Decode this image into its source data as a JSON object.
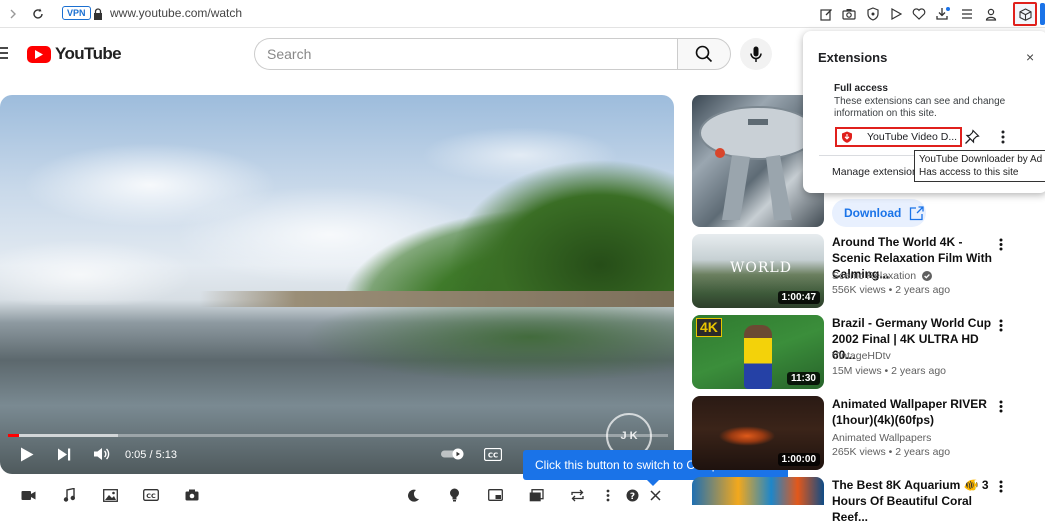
{
  "browser": {
    "vpn_label": "VPN",
    "url": "www.youtube.com/watch"
  },
  "youtube": {
    "logo_text": "YouTube",
    "search_placeholder": "Search"
  },
  "player": {
    "time": "0:05 / 5:13",
    "progress_fraction": 0.016,
    "watermark": "J K"
  },
  "compact_tip": {
    "text": "Click this button to switch to Compact mode.",
    "close": "×"
  },
  "extensions_popup": {
    "title": "Extensions",
    "close": "×",
    "section_title": "Full access",
    "section_desc": "These extensions can see and change information on this site.",
    "item_name": "YouTube Video D...",
    "manage": "Manage extensions"
  },
  "tooltip": {
    "line1": "YouTube Downloader by Ad",
    "line2": "Has access to this site"
  },
  "download_button": "Download",
  "recommended": [
    {
      "title": "Around The World 4K - Scenic Relaxation Film With Calming...",
      "channel": "Scenic Relaxation",
      "verified": true,
      "views": "556K views",
      "age": "2 years ago",
      "duration": "1:00:47",
      "thumb_text": "WORLD"
    },
    {
      "title": "Brazil - Germany World Cup 2002 Final | 4K ULTRA HD 60...",
      "channel": "VintageHDtv",
      "verified": false,
      "views": "15M views",
      "age": "2 years ago",
      "duration": "11:30",
      "thumb_text": "4K"
    },
    {
      "title": "Animated Wallpaper RIVER (1hour)(4k)(60fps)",
      "channel": "Animated Wallpapers",
      "verified": false,
      "views": "265K views",
      "age": "2 years ago",
      "duration": "1:00:00",
      "thumb_text": ""
    },
    {
      "title": "The Best 8K Aquarium 🐠 3 Hours Of Beautiful Coral Reef...",
      "channel": "",
      "verified": false,
      "views": "",
      "age": "",
      "duration": "",
      "thumb_text": ""
    }
  ],
  "colors": {
    "accent": "#1a73e8",
    "youtube_red": "#ff0000",
    "highlight_red": "#e0201c"
  }
}
